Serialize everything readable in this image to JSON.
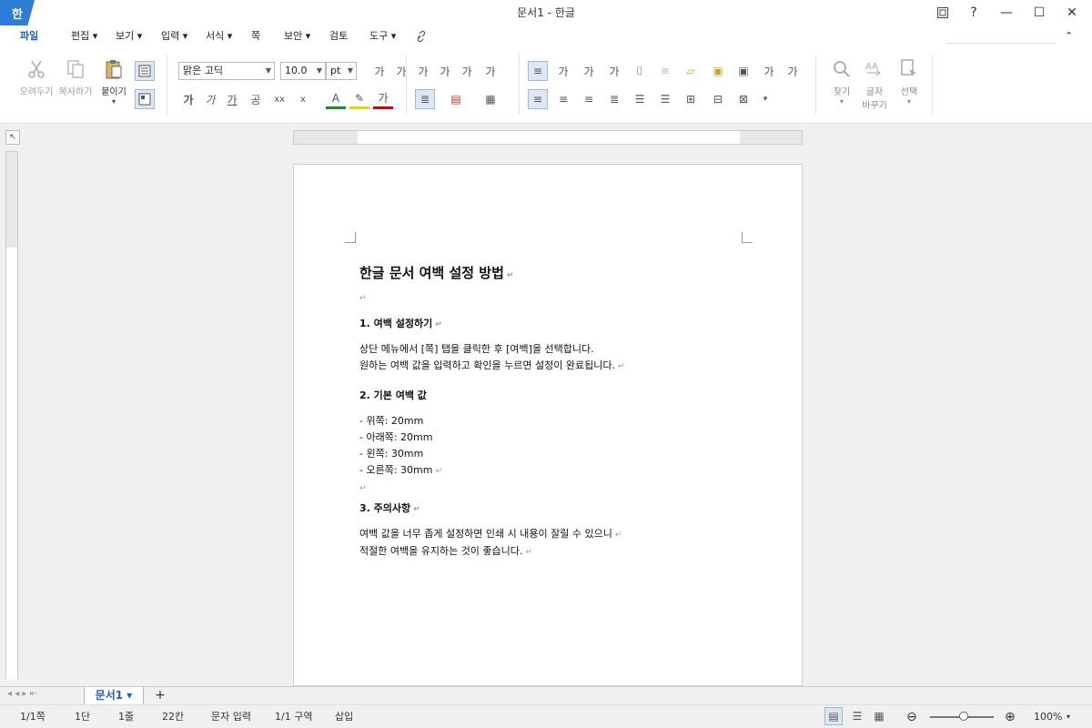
{
  "window": {
    "logo": "한",
    "title": "문서1 - 한글",
    "buttons": {
      "help": "?",
      "minimize": "—",
      "maximize": "☐",
      "close": "✕"
    }
  },
  "menu": {
    "items": [
      "파일",
      "편집 ▾",
      "보기 ▾",
      "입력 ▾",
      "서식 ▾",
      "쪽",
      "보안 ▾",
      "검토",
      "도구 ▾"
    ],
    "right_icon": "⌃"
  },
  "ribbon": {
    "cut_label": "오려두기",
    "copy_label": "복사하기",
    "paste_label": "붙이기",
    "font_name": "맑은 고딕",
    "font_size": "10.0",
    "font_unit": "pt",
    "find_label": "찾기",
    "replace_label_1": "글자",
    "replace_label_2": "바꾸기",
    "select_label": "선택",
    "char_glyph": "가",
    "format_row2": [
      "가",
      "가",
      "가",
      "공",
      "xx",
      "x"
    ]
  },
  "document": {
    "title": "한글 문서 여백 설정 방법",
    "section1": {
      "heading": "1. 여백 설정하기",
      "line1": "상단 메뉴에서 [쪽] 탭을 클릭한 후 [여백]을 선택합니다.",
      "line2": "원하는 여백 값을 입력하고 확인을 누르면 설정이 완료됩니다."
    },
    "section2": {
      "heading": "2. 기본 여백 값",
      "items": [
        "- 위쪽: 20mm",
        "- 아래쪽: 20mm",
        "- 왼쪽: 30mm",
        "- 오른쪽: 30mm"
      ]
    },
    "section3": {
      "heading": "3. 주의사항",
      "line1": "여백 값을 너무 좁게 설정하면 인쇄 시 내용이 잘릴 수 있으니",
      "line2": "적절한 여백을 유지하는 것이 좋습니다."
    },
    "para_mark": "↵"
  },
  "tabs": {
    "doc_tab": "문서1 ▾",
    "add": "+"
  },
  "status": {
    "page": "1/1쪽",
    "column": "1단",
    "line": "1줄",
    "char": "22칸",
    "mode": "문자 입력",
    "section": "1/1 구역",
    "insert": "삽입",
    "zoom": "100%"
  },
  "colors": {
    "accent": "#1e5fb8",
    "logo": "#2e7dd6"
  }
}
